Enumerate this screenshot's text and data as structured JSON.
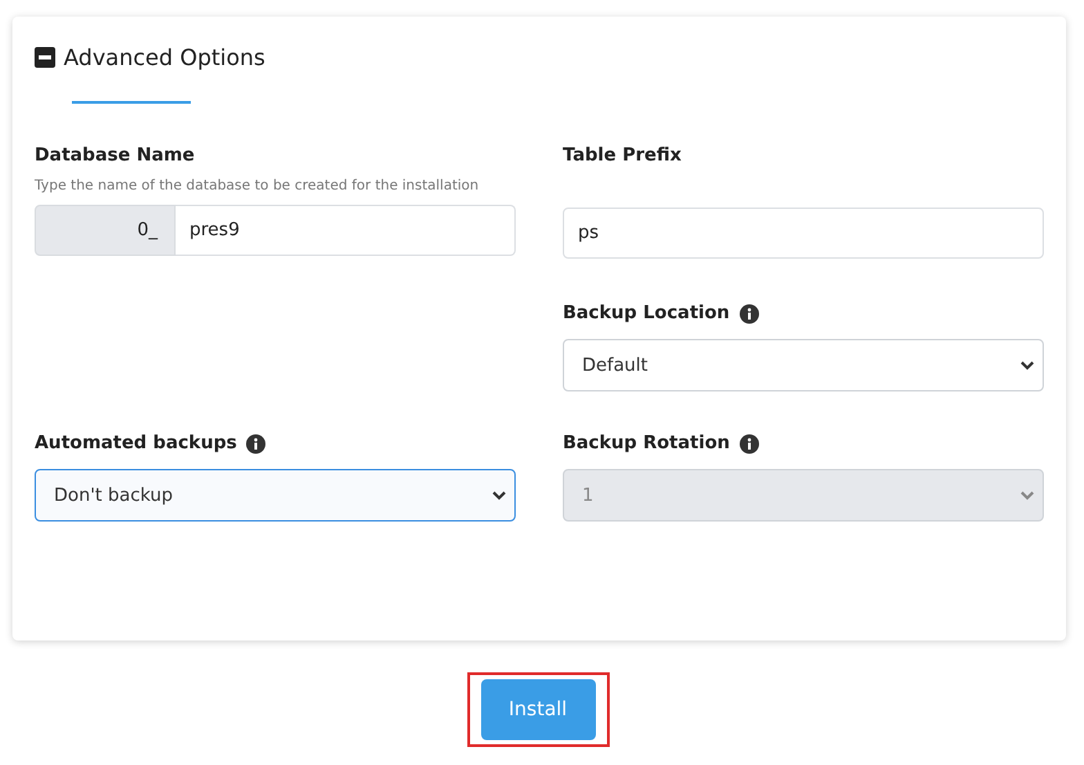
{
  "panel": {
    "title": "Advanced Options",
    "expanded": true
  },
  "database_name": {
    "label": "Database Name",
    "hint": "Type the name of the database to be created for the installation",
    "prefix": "0_",
    "value": "pres9"
  },
  "table_prefix": {
    "label": "Table Prefix",
    "value": "ps"
  },
  "backup_location": {
    "label": "Backup Location",
    "value": "Default",
    "disabled": false,
    "focused": false
  },
  "automated_backups": {
    "label": "Automated backups",
    "value": "Don't backup",
    "disabled": false,
    "focused": true
  },
  "backup_rotation": {
    "label": "Backup Rotation",
    "value": "1",
    "disabled": true,
    "focused": false
  },
  "install_button": {
    "label": "Install",
    "highlighted": true
  }
}
